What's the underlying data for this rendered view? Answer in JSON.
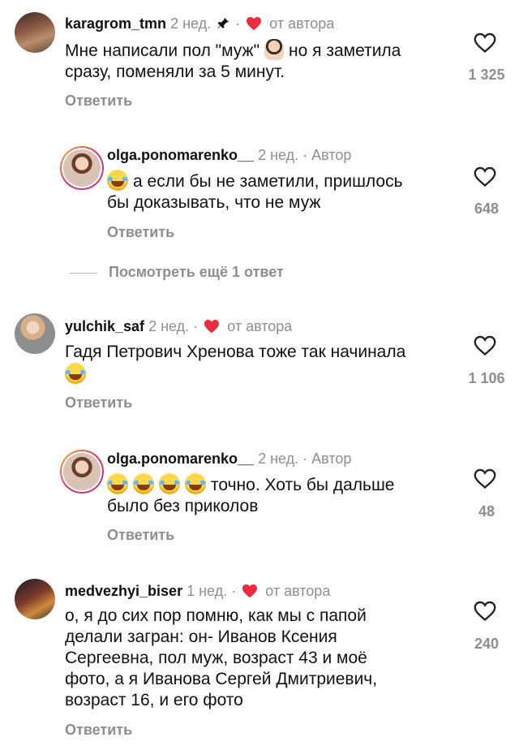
{
  "comments": [
    {
      "username": "karagrom_tmn",
      "time": "2 нед.",
      "dot": "·",
      "badge": "от автора",
      "text_before": "Мне написали пол \"муж\"",
      "text_after": "но я заметила",
      "text_line2": "сразу, поменяли за 5 минут.",
      "likes": "1 325",
      "reply": "Ответить"
    },
    {
      "username": "olga.ponomarenko__",
      "time": "2 нед.",
      "dot": "·",
      "badge": "Автор",
      "text_line1": "а если бы не заметили, пришлось",
      "text_line2": "бы доказывать, что не муж",
      "likes": "648",
      "reply": "Ответить"
    },
    {
      "view_more": "Посмотреть ещё 1 ответ"
    },
    {
      "username": "yulchik_saf",
      "time": "2 нед.",
      "dot": "·",
      "badge": "от автора",
      "text_line1": "Гадя Петрович Хренова тоже так начинала",
      "likes": "1 106",
      "reply": "Ответить"
    },
    {
      "username": "olga.ponomarenko__",
      "time": "2 нед.",
      "dot": "·",
      "badge": "Автор",
      "text_line1": "точно. Хоть бы дальше",
      "text_line2": "было без приколов",
      "likes": "48",
      "reply": "Ответить"
    },
    {
      "username": "medvezhyi_biser",
      "time": "1 нед.",
      "dot": "·",
      "badge": "от автора",
      "text_line1": "о, я до сих пор помню, как мы с папой",
      "text_line2": "делали загран: он- Иванов Ксения",
      "text_line3": "Сергеевна, пол муж, возраст 43 и моё",
      "text_line4": "фото, а я Иванова Сергей Дмитриевич,",
      "text_line5": "возраст 16, и его фото",
      "likes": "240",
      "reply": "Ответить"
    }
  ],
  "icons": {
    "heart_outline": "heart-outline-icon",
    "heart_filled_color": "#ed2d3f",
    "pin": "pin-icon"
  }
}
